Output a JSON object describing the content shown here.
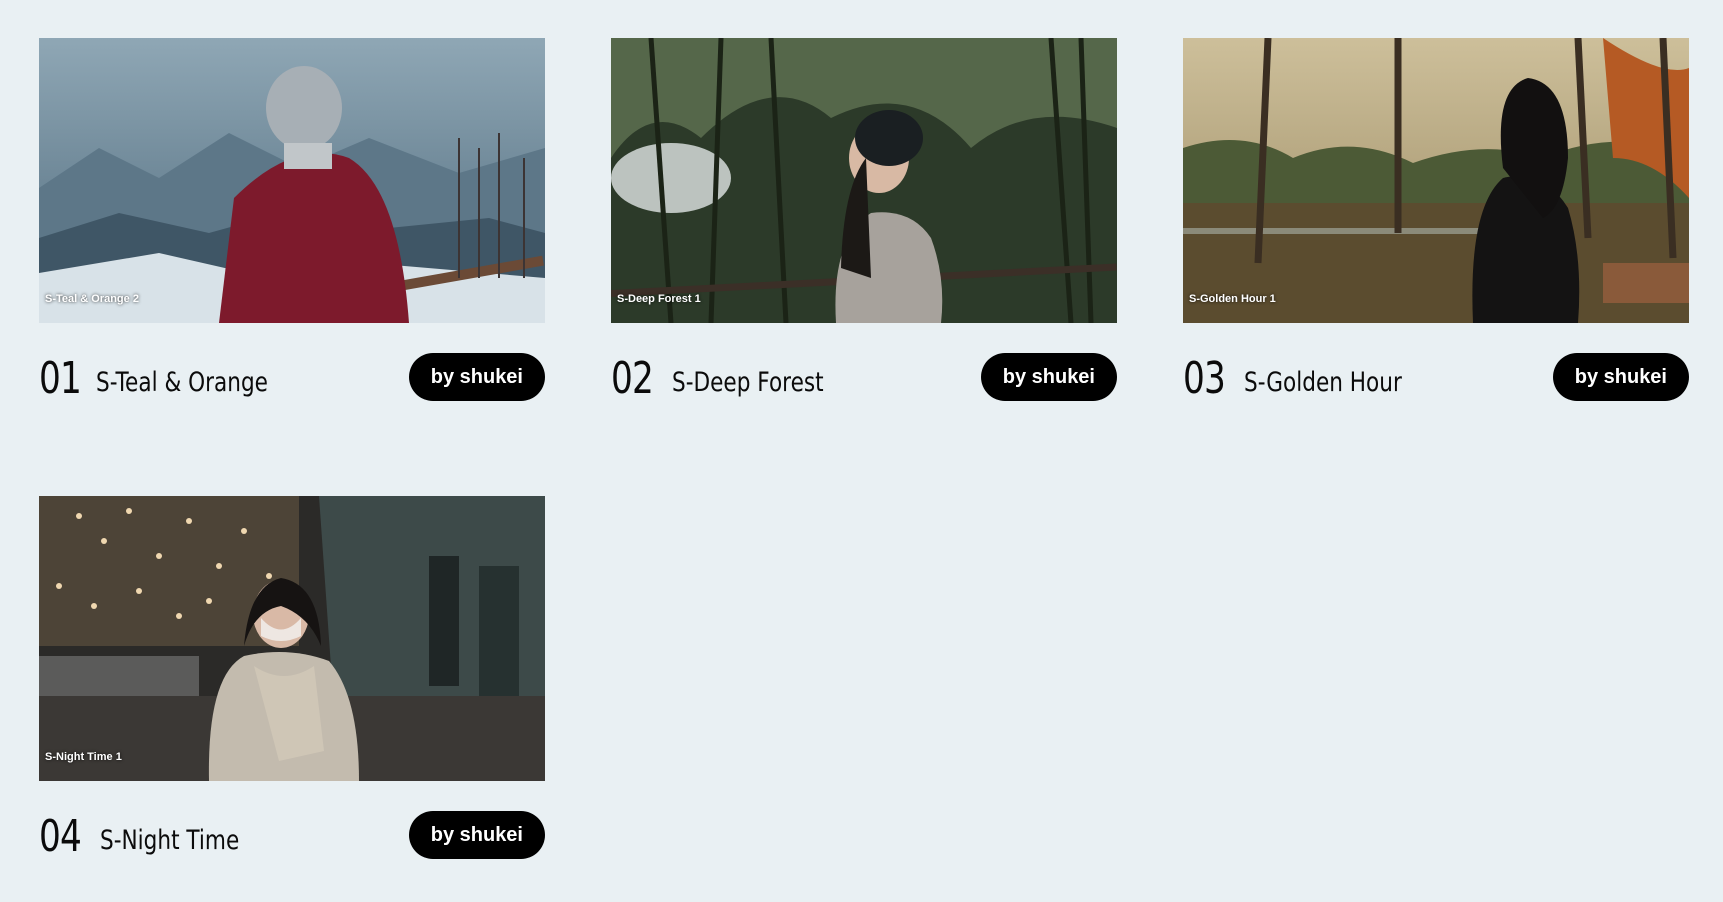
{
  "items": [
    {
      "number": "01",
      "title": "S-Teal & Orange",
      "thumbnail_label": "S-Teal & Orange 2",
      "author": "by shukei"
    },
    {
      "number": "02",
      "title": "S-Deep Forest",
      "thumbnail_label": "S-Deep Forest 1",
      "author": "by shukei"
    },
    {
      "number": "03",
      "title": "S-Golden Hour",
      "thumbnail_label": "S-Golden Hour 1",
      "author": "by shukei"
    },
    {
      "number": "04",
      "title": "S-Night Time",
      "thumbnail_label": "S-Night Time 1",
      "author": "by shukei"
    }
  ],
  "colors": {
    "background": "#e9f0f3",
    "pill": "#000000",
    "pill_text": "#ffffff",
    "text": "#0b0b0b"
  }
}
